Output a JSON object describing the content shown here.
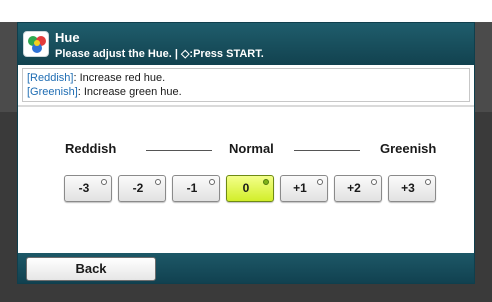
{
  "header": {
    "title": "Hue",
    "subtitle": "Please adjust the Hue. | ◇:Press START."
  },
  "info": {
    "line1_tag": "[Reddish]",
    "line1_text": ": Increase red hue.",
    "line2_tag": "[Greenish]",
    "line2_text": ": Increase green hue."
  },
  "scale": {
    "left": "Reddish",
    "center": "Normal",
    "right": "Greenish"
  },
  "hue_buttons": [
    {
      "label": "-3",
      "selected": false
    },
    {
      "label": "-2",
      "selected": false
    },
    {
      "label": "-1",
      "selected": false
    },
    {
      "label": "0",
      "selected": true
    },
    {
      "label": "+1",
      "selected": false
    },
    {
      "label": "+2",
      "selected": false
    },
    {
      "label": "+3",
      "selected": false
    }
  ],
  "footer": {
    "back_label": "Back"
  },
  "colors": {
    "header_bg": "#1f5d6c",
    "selected_btn": "#d2ee2a",
    "info_tag": "#1f6db3"
  },
  "icons": {
    "app": "color-palette-icon"
  }
}
